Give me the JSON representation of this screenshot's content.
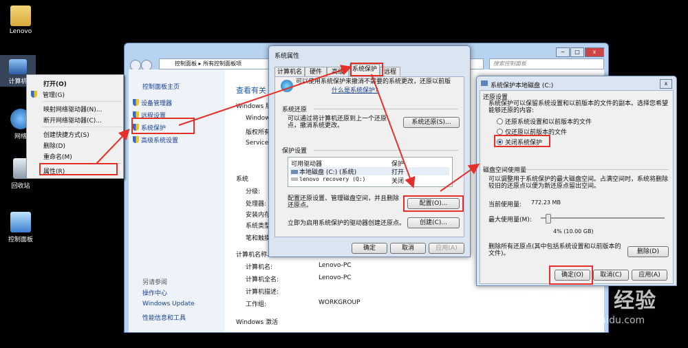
{
  "desktop": {
    "icons": [
      {
        "label": "Lenovo"
      },
      {
        "label": "计算机"
      },
      {
        "label": "网络"
      },
      {
        "label": "回收站"
      },
      {
        "label": "控制面板"
      }
    ]
  },
  "context_menu": {
    "items": [
      "打开(O)",
      "管理(G)",
      "映射网络驱动器(N)...",
      "断开网络驱动器(C)...",
      "创建快捷方式(S)",
      "删除(D)",
      "重命名(M)",
      "属性(R)"
    ]
  },
  "control_panel": {
    "breadcrumb": [
      "控制面板",
      "所有控制面板项"
    ],
    "search_placeholder": "搜索控制面板",
    "left_header": "控制面板主页",
    "left_links": [
      "设备管理器",
      "远程设置",
      "系统保护",
      "高级系统设置"
    ],
    "see_also_title": "另请参阅",
    "see_also": [
      "操作中心",
      "Windows Update",
      "性能信息和工具"
    ],
    "main_title": "查看有关",
    "frag_windows": "Windows 版",
    "frag_win": "Windows",
    "frag_rights": "版权所有",
    "frag_service": "Service",
    "system_head": "系统",
    "system_labels": [
      "分级:",
      "处理器:",
      "安装内存",
      "系统类型"
    ],
    "pen_label": "笔和触摸:",
    "computer_head": "计算机名称、",
    "name_rows": [
      {
        "label": "计算机名:",
        "value": "Lenovo-PC"
      },
      {
        "label": "计算机全名:",
        "value": "Lenovo-PC"
      },
      {
        "label": "计算机描述:",
        "value": ""
      },
      {
        "label": "工作组:",
        "value": "WORKGROUP"
      }
    ],
    "activation_head": "Windows 激活"
  },
  "sys_props": {
    "title": "系统属性",
    "tabs": [
      "计算机名",
      "硬件",
      "高级",
      "系统保护",
      "远程"
    ],
    "intro": "可以使用系统保护来撤消不需要的系统更改，还原以前版",
    "intro_link": "什么是系统保护?",
    "restore_head": "系统还原",
    "restore_text": "可以通过将计算机还原到上一个还原点，撤消系统更改。",
    "restore_btn": "系统还原(S)...",
    "settings_head": "保护设置",
    "col_drive": "可用驱动器",
    "col_protect": "保护",
    "drives": [
      {
        "name": "本地磁盘 (C:) (系统)",
        "status": "打开"
      },
      {
        "name": "lenovo recovery (Q:)",
        "status": "关闭"
      }
    ],
    "config_text": "配置还原设置、管理磁盘空间，并且删除还原点。",
    "config_btn": "配置(O)...",
    "create_text": "立即为启用系统保护的驱动器创建还原点。",
    "create_btn": "创建(C)...",
    "ok": "确定",
    "cancel": "取消",
    "apply": "应用(A)"
  },
  "disk_dlg": {
    "title": "系统保护本地磁盘 (C:)",
    "restore_head": "还原设置",
    "restore_desc": "系统保护可以保留系统设置和以前版本的文件的副本。选择您希望能够还原的内容:",
    "options": [
      "还原系统设置和以前版本的文件",
      "仅还原以前版本的文件",
      "关闭系统保护"
    ],
    "selected": 2,
    "usage_head": "磁盘空间使用量",
    "usage_desc": "可以调整用于系统保护的最大磁盘空间。占满空间时，系统将删除较旧的还原点以便为新还原点留出空间。",
    "current_label": "当前使用量:",
    "current_value": "772.23 MB",
    "max_label": "最大使用量(M):",
    "max_value": "4% (10.00 GB)",
    "max_fraction": 0.04,
    "delete_text": "删除所有还原点(其中包括系统设置和以前版本的文件)。",
    "delete_btn": "删除(D)",
    "ok": "确定(O)",
    "cancel": "取消(C)",
    "apply": "应用(A)"
  },
  "watermark": {
    "brand": "Bai du 经验",
    "url": "jingyan.baidu.com"
  },
  "colors": {
    "highlight": "#e5302a",
    "link": "#1a3e8c"
  }
}
